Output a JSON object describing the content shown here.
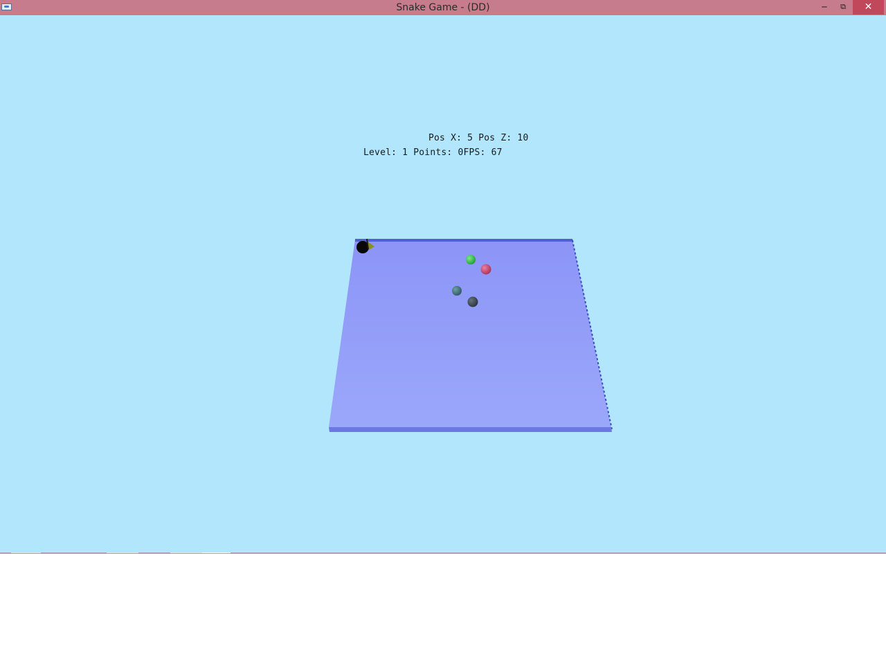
{
  "window": {
    "title": "Snake Game - (DD)",
    "app_icon": "window-app-icon",
    "controls": {
      "minimize_glyph": "‒",
      "maximize_glyph": "⧉",
      "close_glyph": "✕"
    }
  },
  "hud": {
    "position_text": "Pos X: 5 Pos Z: 10",
    "stats_text": "Level: 1 Points: 0FPS: 67"
  },
  "game": {
    "sky_color": "#b1e6fd",
    "board_color": "#8f9af6",
    "board_edge_color": "#5866d6",
    "objects": [
      {
        "kind": "snake-head",
        "color": "#0a0a0a"
      },
      {
        "kind": "snake-marker",
        "color": "#8a8f1e"
      },
      {
        "kind": "food",
        "color": "#2fbf4a"
      },
      {
        "kind": "food",
        "color": "#c8436e"
      },
      {
        "kind": "food",
        "color": "#3f6f7a"
      },
      {
        "kind": "food",
        "color": "#3a4650"
      }
    ]
  }
}
